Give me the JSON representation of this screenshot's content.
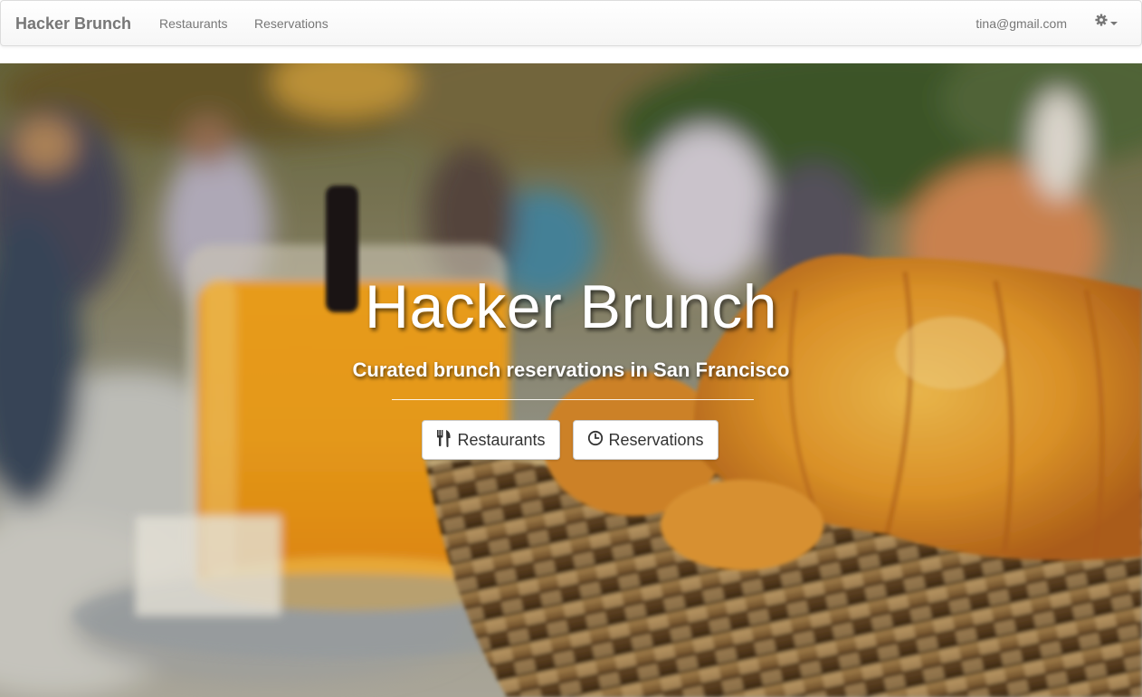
{
  "navbar": {
    "brand": "Hacker Brunch",
    "links": [
      "Restaurants",
      "Reservations"
    ],
    "user_email": "tina@gmail.com",
    "settings_icon": "gear-icon"
  },
  "hero": {
    "title": "Hacker Brunch",
    "subtitle": "Curated brunch reservations in San Francisco",
    "buttons": [
      {
        "label": "Restaurants",
        "icon": "cutlery-icon"
      },
      {
        "label": "Reservations",
        "icon": "clock-icon"
      }
    ]
  },
  "colors": {
    "nav_text": "#777777",
    "button_text": "#333333",
    "hero_text": "#ffffff"
  }
}
